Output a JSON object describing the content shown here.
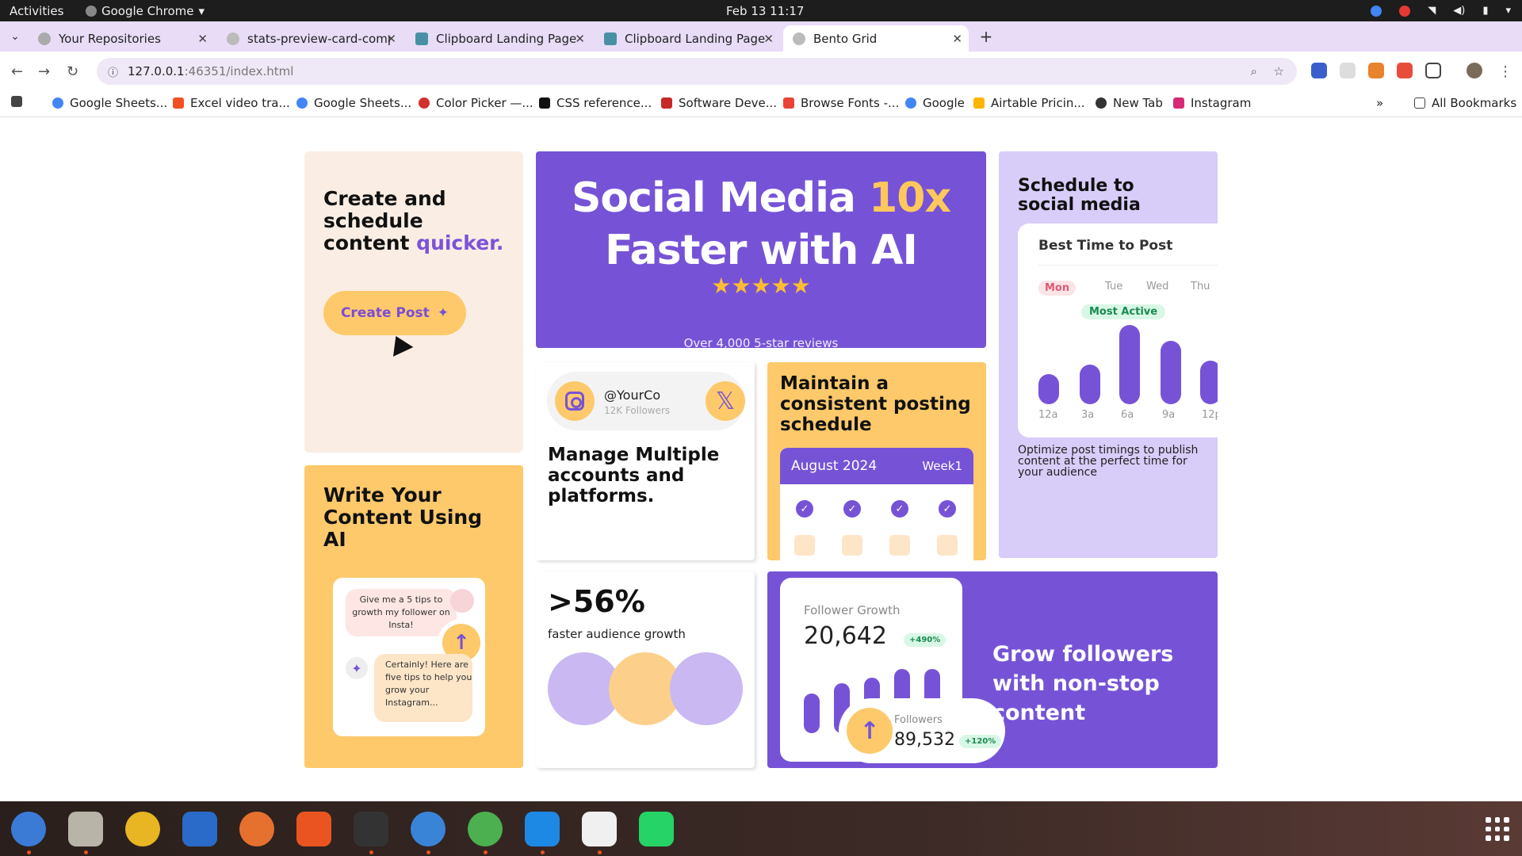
{
  "system": {
    "activities": "Activities",
    "app_name": "Google Chrome",
    "clock": "Feb 13  11:17"
  },
  "tabs": [
    {
      "title": "Your Repositories"
    },
    {
      "title": "stats-preview-card-comp"
    },
    {
      "title": "Clipboard Landing Page"
    },
    {
      "title": "Clipboard Landing Page"
    },
    {
      "title": "Bento Grid",
      "active": true
    }
  ],
  "address": {
    "host": "127.0.0.1",
    "rest": ":46351/index.html"
  },
  "bookmarks": [
    "Google Sheets...",
    "Excel video tra...",
    "Google Sheets...",
    "Color Picker —...",
    "CSS reference...",
    "Software Deve...",
    "Browse Fonts -...",
    "Google",
    "Airtable Pricin...",
    "New Tab",
    "Instagram"
  ],
  "all_bookmarks": "All Bookmarks",
  "bento": {
    "create": {
      "line1": "Create and schedule content",
      "highlight": "quicker.",
      "button": "Create Post"
    },
    "hero": {
      "part1": "Social Media ",
      "accent": "10x",
      "part2": " Faster with AI",
      "reviews": "Over 4,000 5-star reviews",
      "stars": "★★★★★"
    },
    "schedule": {
      "title": "Schedule to social media",
      "widget_title": "Best Time to Post",
      "days": [
        "Mon",
        "Tue",
        "Wed",
        "Thu"
      ],
      "badge": "Most Active",
      "times": [
        "12a",
        "3a",
        "6a",
        "9a",
        "12p"
      ],
      "activity_levels": [
        0.38,
        0.5,
        1.0,
        0.8,
        0.55
      ],
      "desc": "Optimize post timings to publish content at the perfect time for your audience"
    },
    "write": {
      "title": "Write Your Content Using AI",
      "prompt": "Give me a 5 tips to growth my follower on Insta!",
      "reply": "Certainly! Here are five tips to help you grow your Instagram..."
    },
    "accounts": {
      "handle": "@YourCo",
      "followers": "12K Followers",
      "x_label": "𝕏",
      "title": "Manage Multiple accounts and platforms."
    },
    "posting": {
      "title": "Maintain a consistent posting schedule",
      "month": "August 2024",
      "week": "Week1"
    },
    "growth_stat": {
      "value": ">56%",
      "label": "faster audience growth"
    },
    "followers": {
      "widget_title": "Follower Growth",
      "count": "20,642",
      "pct": "+490%",
      "bar_levels": [
        0.55,
        0.7,
        0.78,
        0.9,
        0.9
      ],
      "followers_label": "Followers",
      "followers_count": "89,532",
      "followers_pct": "+120%",
      "headline": "Grow followers with non-stop content"
    }
  },
  "colors": {
    "purple": "#7653d6",
    "yellow": "#fdc96b",
    "peach": "#faeee4",
    "lavender": "#d8ccf8"
  }
}
